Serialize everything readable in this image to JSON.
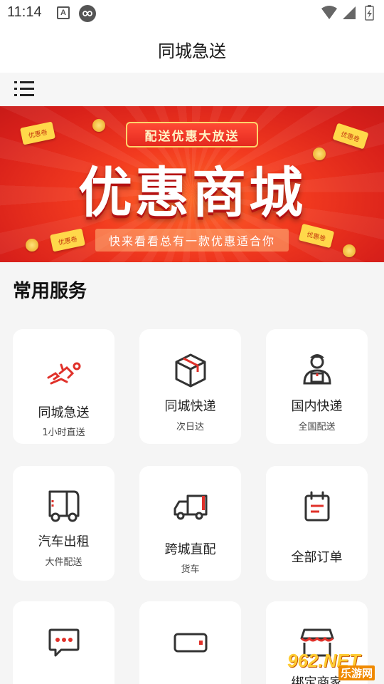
{
  "status_bar": {
    "time": "11:14",
    "notification_icon_label": "A"
  },
  "app_bar": {
    "title": "同城急送"
  },
  "banner": {
    "tag": "配送优惠大放送",
    "title": "优惠商城",
    "subtitle": "快来看看总有一款优惠适合你",
    "coupon_label": "优惠卷",
    "coin_symbol": "¥"
  },
  "section": {
    "title": "常用服务"
  },
  "services": [
    {
      "label": "同城急送",
      "sub": "1小时直送",
      "icon": "running-courier-icon"
    },
    {
      "label": "同城快递",
      "sub": "次日达",
      "icon": "package-box-icon"
    },
    {
      "label": "国内快递",
      "sub": "全国配送",
      "icon": "delivery-person-icon"
    },
    {
      "label": "汽车出租",
      "sub": "大件配送",
      "icon": "van-icon"
    },
    {
      "label": "跨城直配",
      "sub": "货车",
      "icon": "truck-icon"
    },
    {
      "label": "全部订单",
      "sub": "",
      "icon": "order-list-icon"
    },
    {
      "label": "",
      "sub": "",
      "icon": "chat-message-icon"
    },
    {
      "label": "",
      "sub": "",
      "icon": "wallet-icon"
    },
    {
      "label": "绑定商家",
      "sub": "",
      "icon": "storefront-icon"
    }
  ],
  "watermark": {
    "logo": "962.NET",
    "site": "乐游网"
  },
  "colors": {
    "accent_red": "#e0312a",
    "banner_red": "#e83220",
    "icon_dark": "#333333"
  }
}
